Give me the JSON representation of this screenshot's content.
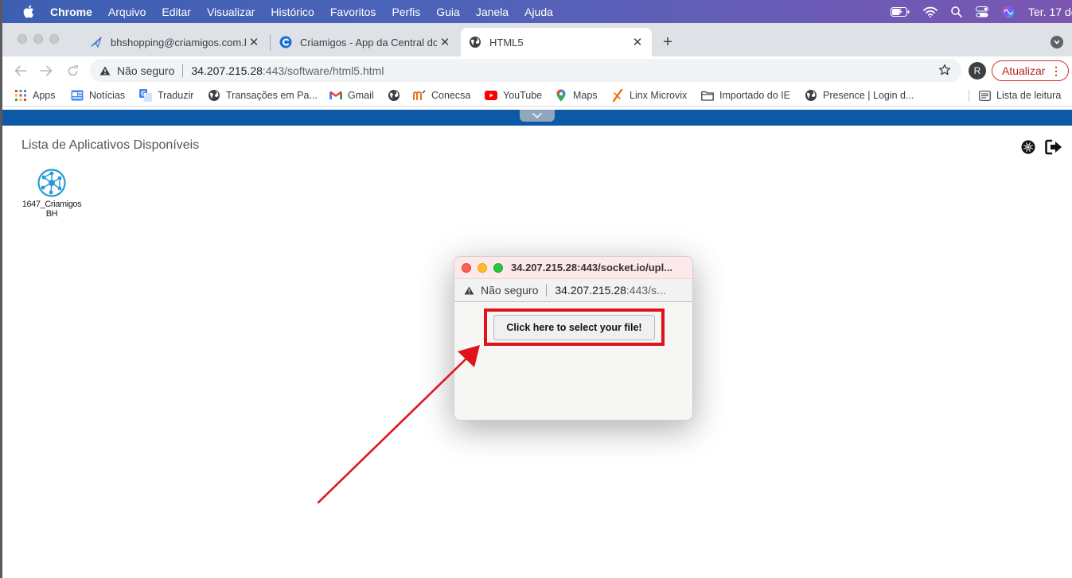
{
  "menubar": {
    "app_name": "Chrome",
    "menus": [
      "Arquivo",
      "Editar",
      "Visualizar",
      "Histórico",
      "Favoritos",
      "Perfis",
      "Guia",
      "Janela",
      "Ajuda"
    ],
    "clock": "Ter. 17 de"
  },
  "tabs": [
    {
      "title": "bhshopping@criamigos.com.br",
      "icon": "paper-plane-icon",
      "active": false
    },
    {
      "title": "Criamigos - App da Central do",
      "icon": "criamigos-c-icon",
      "active": false
    },
    {
      "title": "HTML5",
      "icon": "globe-icon",
      "active": true
    }
  ],
  "toolbar": {
    "security_label": "Não seguro",
    "url_host": "34.207.215.28",
    "url_path": ":443/software/html5.html",
    "avatar_letter": "R",
    "update_label": "Atualizar"
  },
  "bookmarks": [
    {
      "label": "Apps",
      "icon": "apps-grid-icon"
    },
    {
      "label": "Notícias",
      "icon": "news-icon"
    },
    {
      "label": "Traduzir",
      "icon": "translate-icon"
    },
    {
      "label": "Transações em Pa...",
      "icon": "globe-icon"
    },
    {
      "label": "Gmail",
      "icon": "gmail-icon"
    },
    {
      "label": "",
      "icon": "globe-icon"
    },
    {
      "label": "Conecsa",
      "icon": "conecsa-icon"
    },
    {
      "label": "YouTube",
      "icon": "youtube-icon"
    },
    {
      "label": "Maps",
      "icon": "maps-pin-icon"
    },
    {
      "label": "Linx Microvix",
      "icon": "linx-icon"
    },
    {
      "label": "Importado do IE",
      "icon": "folder-icon"
    },
    {
      "label": "Presence | Login d...",
      "icon": "globe-icon"
    }
  ],
  "reading_list_label": "Lista de leitura",
  "page": {
    "title": "Lista de Aplicativos Disponíveis",
    "app_label": "1647_CriamigosBH"
  },
  "popup": {
    "title": "34.207.215.28:443/socket.io/upl...",
    "security_label": "Não seguro",
    "url_host": "34.207.215.28",
    "url_path": ":443/s...",
    "button_label": "Click here to select your file!"
  },
  "colors": {
    "blue_bar": "#0c5aa6",
    "annotation_red": "#e0131b"
  }
}
